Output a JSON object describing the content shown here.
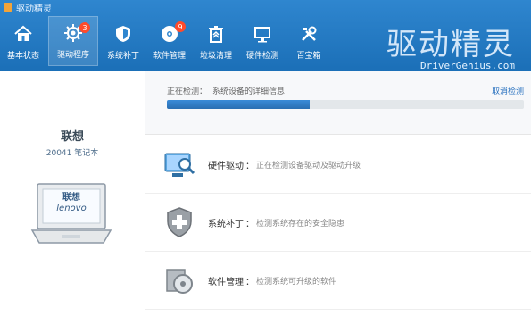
{
  "app": {
    "title": "驱动精灵"
  },
  "toolbar": {
    "items": [
      {
        "label": "基本状态",
        "icon": "home-icon",
        "active": false
      },
      {
        "label": "驱动程序",
        "icon": "gear-icon",
        "active": true,
        "badge": "3"
      },
      {
        "label": "系统补丁",
        "icon": "shield-icon",
        "active": false
      },
      {
        "label": "软件管理",
        "icon": "disc-icon",
        "active": false,
        "badge": "9"
      },
      {
        "label": "垃圾清理",
        "icon": "trash-icon",
        "active": false
      },
      {
        "label": "硬件检测",
        "icon": "monitor-icon",
        "active": false
      },
      {
        "label": "百宝箱",
        "icon": "tools-icon",
        "active": false
      }
    ]
  },
  "brand": {
    "title": "驱动精灵",
    "sub": "DriverGenius.com"
  },
  "device": {
    "brand": "联想",
    "model": "20041 笔记本",
    "laptop_logo_line1": "联想",
    "laptop_logo_line2": "lenovo"
  },
  "scan": {
    "label": "正在检测：",
    "status": "系统设备的详细信息",
    "cancel": "取消检测",
    "progress": 0.4
  },
  "list": {
    "items": [
      {
        "title": "硬件驱动",
        "desc": "正在检测设备驱动及驱动升级",
        "icon": "hardware-driver-icon"
      },
      {
        "title": "系统补丁",
        "desc": "检测系统存在的安全隐患",
        "icon": "shield-plus-icon"
      },
      {
        "title": "软件管理",
        "desc": "检测系统可升级的软件",
        "icon": "software-disc-icon"
      }
    ]
  }
}
